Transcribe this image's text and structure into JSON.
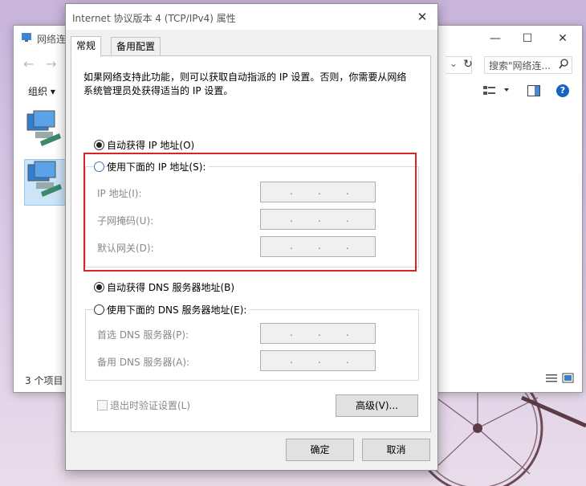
{
  "explorer": {
    "title": "网络连",
    "search_placeholder": "搜索\"网络连...",
    "organize_label": "组织 ▾",
    "status_count": "3 个项目"
  },
  "dialog": {
    "title": "Internet 协议版本 4 (TCP/IPv4) 属性",
    "tabs": [
      "常规",
      "备用配置"
    ],
    "description": "如果网络支持此功能，则可以获取自动指派的 IP 设置。否则，你需要从网络系统管理员处获得适当的 IP 设置。",
    "ip_auto_label": "自动获得 IP 地址(O)",
    "ip_manual_label": "使用下面的 IP 地址(S):",
    "ip_fields": [
      {
        "label": "IP 地址(I):"
      },
      {
        "label": "子网掩码(U):"
      },
      {
        "label": "默认网关(D):"
      }
    ],
    "dns_auto_label": "自动获得 DNS 服务器地址(B)",
    "dns_manual_label": "使用下面的 DNS 服务器地址(E):",
    "dns_fields": [
      {
        "label": "首选 DNS 服务器(P):"
      },
      {
        "label": "备用 DNS 服务器(A):"
      }
    ],
    "validate_label": "退出时验证设置(L)",
    "advanced_button": "高级(V)...",
    "ok_button": "确定",
    "cancel_button": "取消",
    "ip_selection": "auto",
    "dns_selection": "auto"
  },
  "colors": {
    "highlight_border": "#d8232a",
    "accent": "#1764c0"
  }
}
